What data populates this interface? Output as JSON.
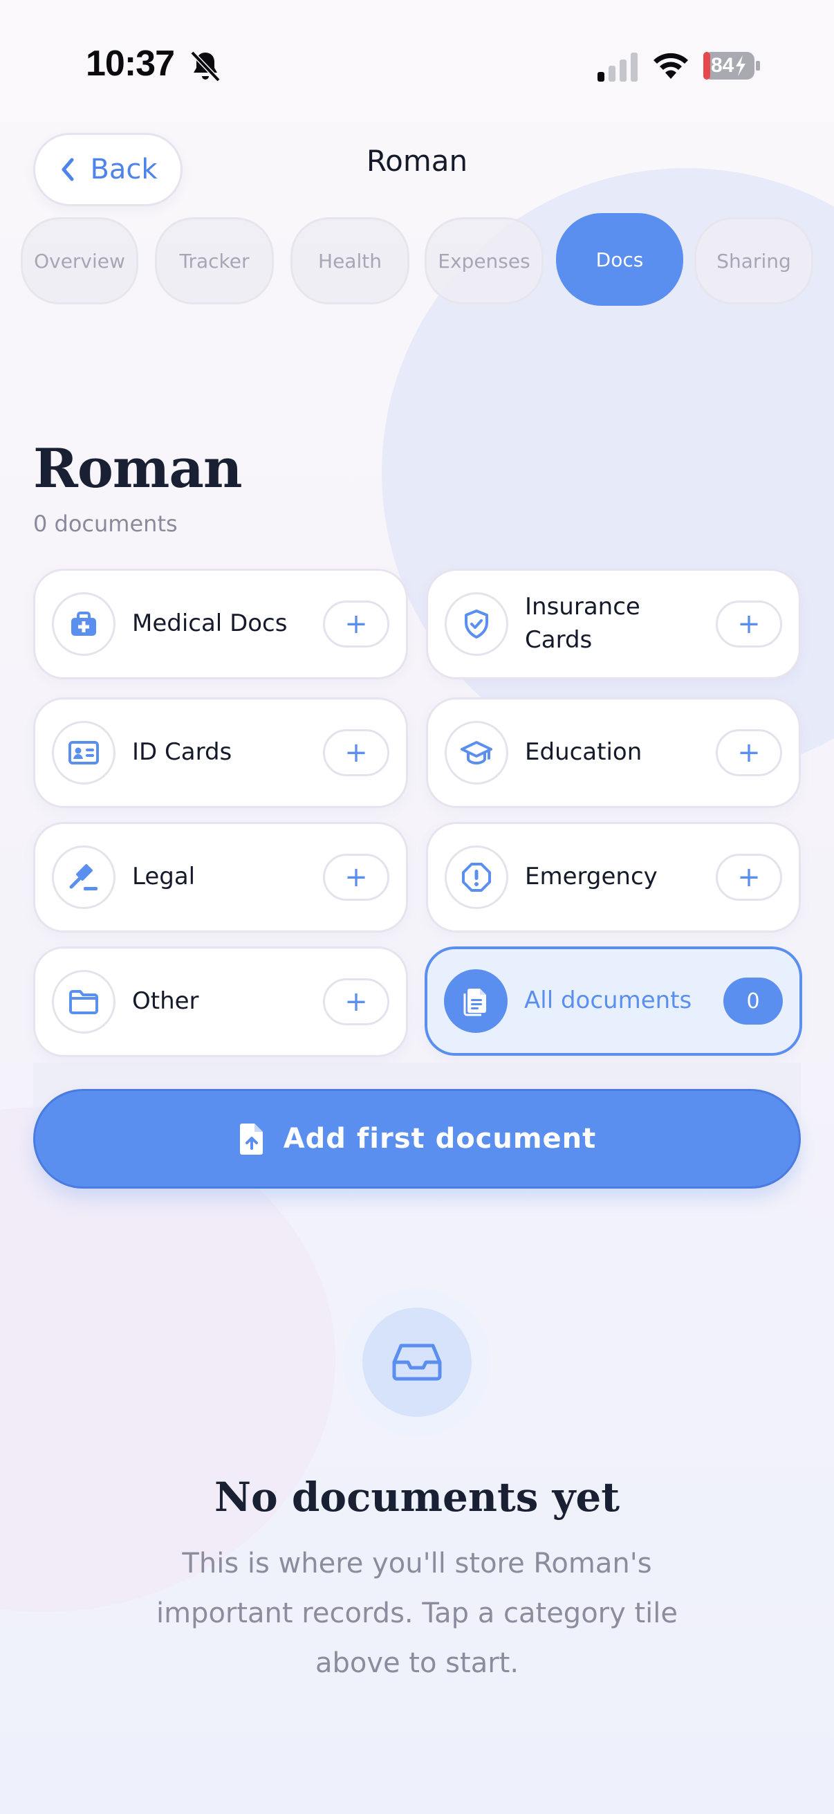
{
  "status_bar": {
    "time": "10:37",
    "battery": "84"
  },
  "header": {
    "back_label": "Back",
    "title": "Roman"
  },
  "tabs": [
    {
      "label": "Overview",
      "active": false
    },
    {
      "label": "Tracker",
      "active": false
    },
    {
      "label": "Health",
      "active": false
    },
    {
      "label": "Expenses",
      "active": false
    },
    {
      "label": "Docs",
      "active": true
    },
    {
      "label": "Sharing",
      "active": false
    }
  ],
  "page": {
    "name": "Roman",
    "doc_count": "0 documents"
  },
  "categories": [
    {
      "label": "Medical Docs",
      "icon": "medical-kit-icon",
      "action": "+"
    },
    {
      "label": "Insurance Cards",
      "icon": "shield-check-icon",
      "action": "+"
    },
    {
      "label": "ID Cards",
      "icon": "id-card-icon",
      "action": "+"
    },
    {
      "label": "Education",
      "icon": "graduation-cap-icon",
      "action": "+"
    },
    {
      "label": "Legal",
      "icon": "gavel-icon",
      "action": "+"
    },
    {
      "label": "Emergency",
      "icon": "alert-icon",
      "action": "+"
    },
    {
      "label": "Other",
      "icon": "folder-icon",
      "action": "+"
    },
    {
      "label": "All documents",
      "icon": "documents-icon",
      "count": "0"
    }
  ],
  "add_button": {
    "label": "Add first document"
  },
  "empty_state": {
    "title": "No documents yet",
    "text": "This is where you'll store Roman's important records. Tap a category tile above to start."
  },
  "colors": {
    "accent": "#5a8ff0",
    "heading": "#1a2034",
    "muted": "#8b8c9d"
  }
}
